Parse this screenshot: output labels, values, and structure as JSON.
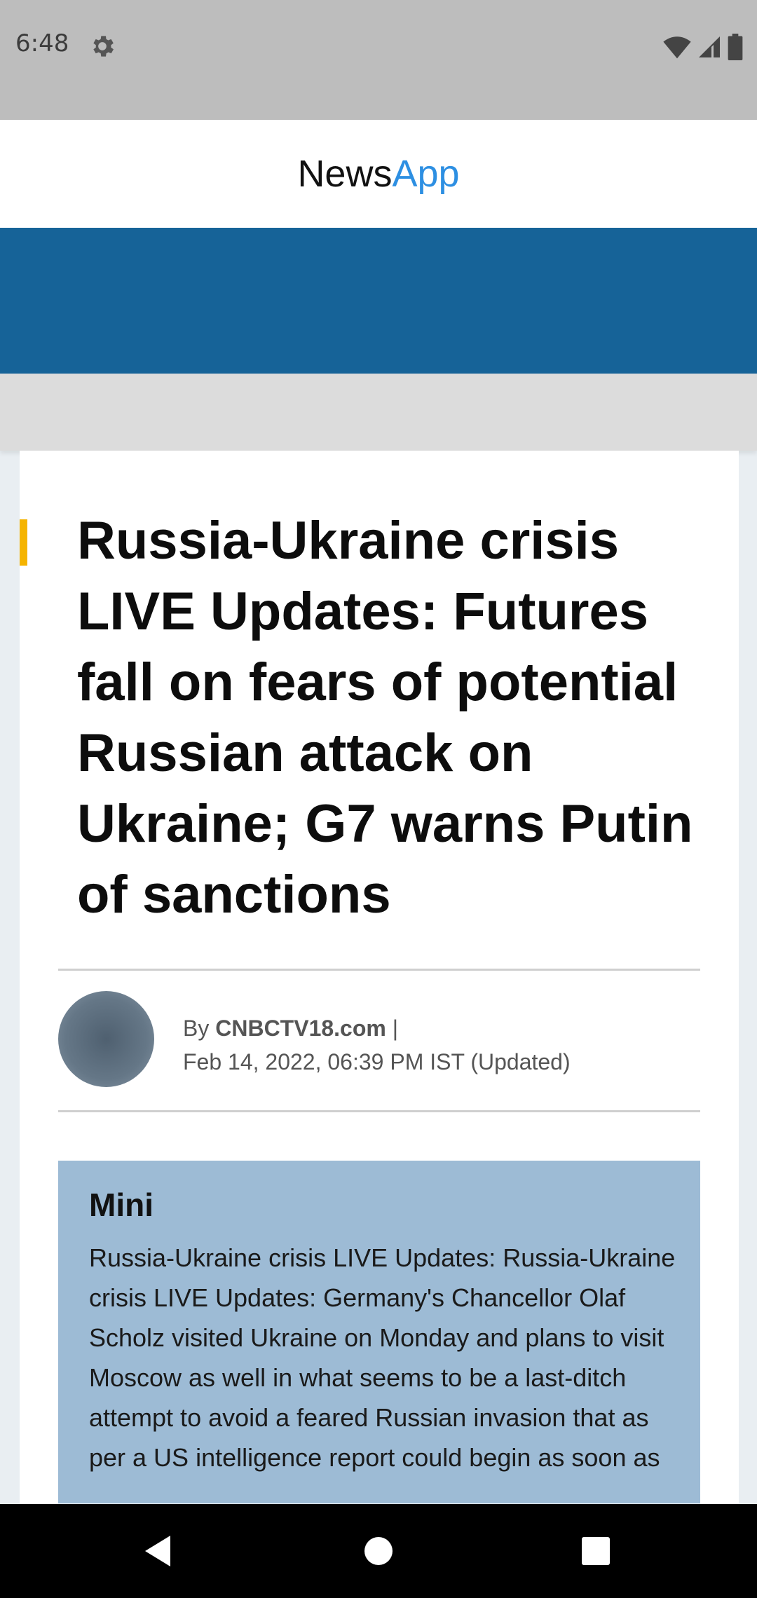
{
  "status_bar": {
    "time": "6:48",
    "icons": [
      "gear-icon",
      "wifi-icon",
      "signal-icon",
      "battery-icon"
    ]
  },
  "header": {
    "brand_part1": "News",
    "brand_part2": "App"
  },
  "article": {
    "title": "Russia-Ukraine crisis LIVE Updates: Futures fall on fears of potential Russian attack on Ukraine; G7 warns Putin of sanctions",
    "byline_prefix": "By ",
    "author": "CNBCTV18.com",
    "separator": " |",
    "date": "Feb 14, 2022, 06:39 PM IST (Updated)"
  },
  "mini": {
    "heading": "Mini",
    "text": "Russia-Ukraine crisis LIVE Updates: Russia-Ukraine crisis LIVE Updates: Germany's Chancellor Olaf Scholz visited Ukraine on Monday and plans to visit Moscow as well in what seems to be a last-ditch attempt to avoid a feared Russian invasion that as per a US intelligence report could begin as soon as"
  },
  "nav_bar": {
    "buttons": [
      "back-icon",
      "home-icon",
      "recents-icon"
    ]
  },
  "colors": {
    "status_bar": "#bdbdbd",
    "brand_accent": "#2d8fe2",
    "banner": "#166398",
    "title_accent": "#f5b400",
    "mini_box": "#9dbbd5"
  }
}
